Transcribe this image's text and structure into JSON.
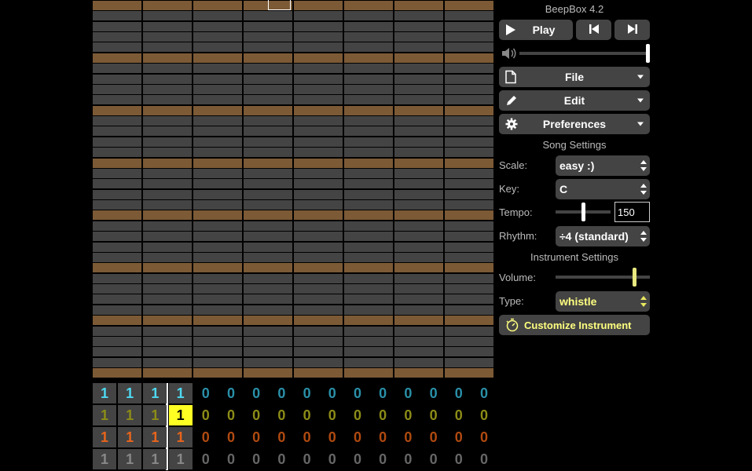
{
  "app": {
    "title": "BeepBox 4.2"
  },
  "pattern_rows": [
    "brown",
    "gray",
    "gray",
    "gray",
    "gray",
    "brown",
    "gray",
    "gray",
    "gray",
    "gray",
    "brown",
    "gray",
    "gray",
    "gray",
    "gray",
    "brown",
    "gray",
    "gray",
    "gray",
    "gray",
    "brown",
    "gray",
    "gray",
    "gray",
    "gray",
    "brown",
    "gray",
    "gray",
    "gray",
    "gray",
    "brown",
    "gray",
    "gray",
    "gray",
    "gray",
    "brown"
  ],
  "transport": {
    "play_label": "Play"
  },
  "menus": {
    "file_label": "File",
    "edit_label": "Edit",
    "preferences_label": "Preferences"
  },
  "song_settings": {
    "header": "Song Settings",
    "scale_label": "Scale:",
    "scale_value": "easy :)",
    "key_label": "Key:",
    "key_value": "C",
    "tempo_label": "Tempo:",
    "tempo_value": "150",
    "tempo_slider_fraction": 0.5,
    "rhythm_label": "Rhythm:",
    "rhythm_value": "÷4 (standard)"
  },
  "instrument_settings": {
    "header": "Instrument Settings",
    "volume_label": "Volume:",
    "volume_fraction": 0.85,
    "type_label": "Type:",
    "type_value": "whistle",
    "customize_label": "Customize Instrument"
  },
  "master_volume_fraction": 1.0,
  "tracks": [
    {
      "color": "#4ed8f0",
      "dim": "#2a90a8",
      "values": [
        "1",
        "1",
        "1",
        "1",
        "0",
        "0",
        "0",
        "0",
        "0",
        "0",
        "0",
        "0",
        "0",
        "0",
        "0",
        "0"
      ]
    },
    {
      "color": "#c8c83c",
      "dim": "#8c8c18",
      "values": [
        "1",
        "1",
        "1",
        "1",
        "0",
        "0",
        "0",
        "0",
        "0",
        "0",
        "0",
        "0",
        "0",
        "0",
        "0",
        "0"
      ],
      "selected_index": 3
    },
    {
      "color": "#e8641c",
      "dim": "#b04a10",
      "values": [
        "1",
        "1",
        "1",
        "1",
        "0",
        "0",
        "0",
        "0",
        "0",
        "0",
        "0",
        "0",
        "0",
        "0",
        "0",
        "0"
      ]
    },
    {
      "color": "#888888",
      "dim": "#666666",
      "values": [
        "1",
        "1",
        "1",
        "1",
        "0",
        "0",
        "0",
        "0",
        "0",
        "0",
        "0",
        "0",
        "0",
        "0",
        "0",
        "0"
      ]
    }
  ],
  "colors": {
    "accent_yellow": "#ffff24",
    "brown_row": "#7c5a36",
    "gray_row": "#444444"
  }
}
